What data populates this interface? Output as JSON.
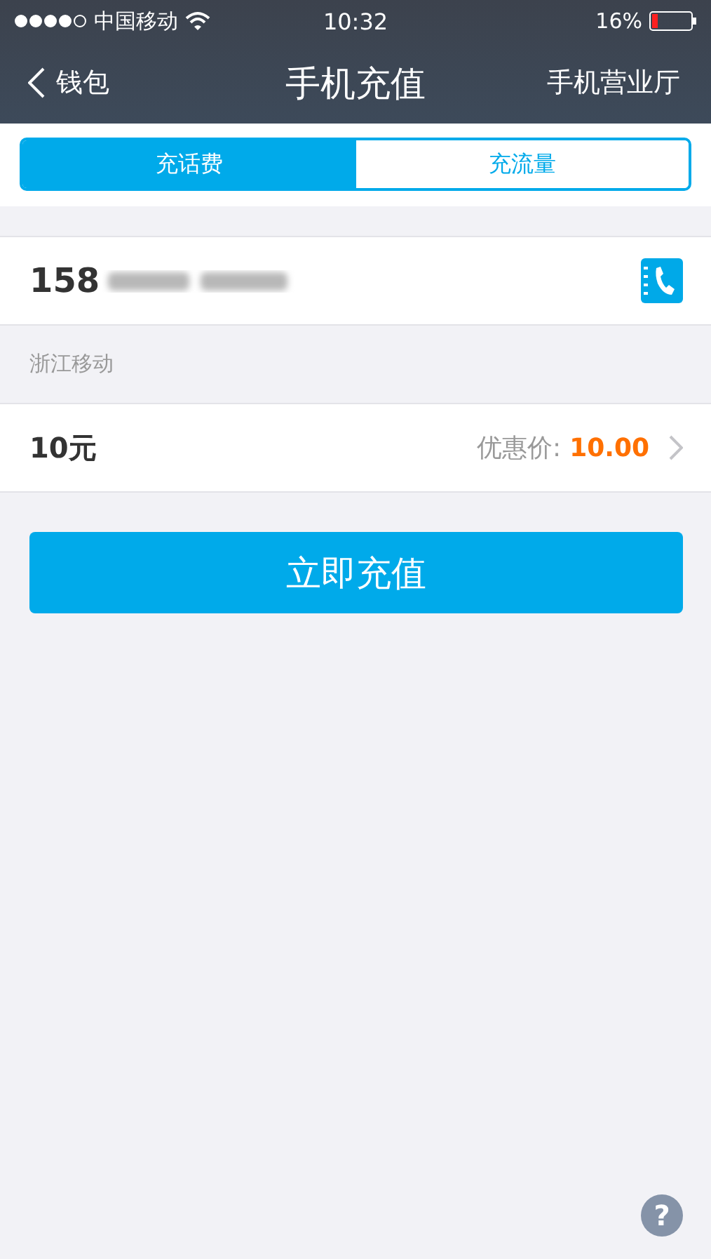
{
  "status_bar": {
    "carrier": "中国移动",
    "time": "10:32",
    "battery": "16%"
  },
  "nav": {
    "back": "钱包",
    "title": "手机充值",
    "action": "手机营业厅"
  },
  "tabs": [
    {
      "label": "充话费",
      "selected": true
    },
    {
      "label": "充流量",
      "selected": false
    }
  ],
  "phone": {
    "prefix": "158"
  },
  "carrier_name": "浙江移动",
  "amount": {
    "value": "10元",
    "price_label": "优惠价:",
    "price": "10.00"
  },
  "submit": "立即充值",
  "help": "?"
}
